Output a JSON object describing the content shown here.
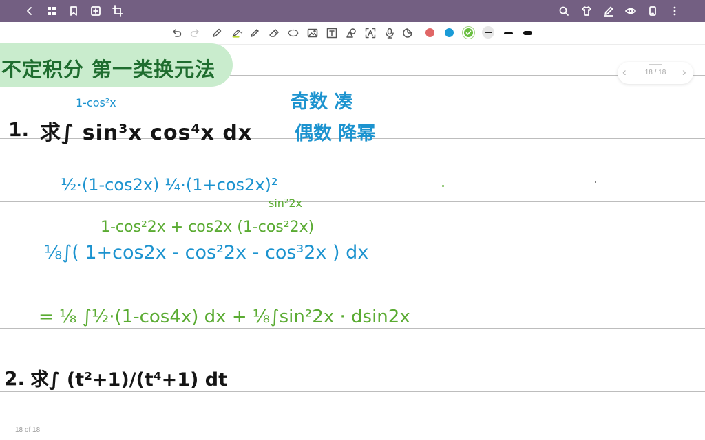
{
  "title_text": "不定积分 第一类换元法",
  "pager": {
    "text": "18 / 18",
    "prev": "‹",
    "next": "›"
  },
  "footer": {
    "page_count": "18 of 18"
  },
  "colors": {
    "topbar": "#735f82",
    "title_band": "#c9eccd",
    "ink_blue": "#1c93cf",
    "ink_green": "#5aab32",
    "swatch_red": "#e06666",
    "swatch_blue": "#1a9bd7",
    "swatch_green": "#6abf40",
    "swatch_gray": "#e6e6e6"
  },
  "topbar_icons": {
    "left": [
      "back-icon",
      "grid-icon",
      "bookmark-icon",
      "add-page-icon",
      "crop-icon"
    ],
    "right": [
      "search-icon",
      "tshirt-icon",
      "pen-mode-icon",
      "eye-icon",
      "tablet-icon",
      "more-icon"
    ]
  },
  "toolbar_tools": [
    "undo-icon",
    "redo-icon",
    "pen-icon",
    "highlighter-icon",
    "pencil-icon",
    "eraser-icon",
    "lasso-icon",
    "image-icon",
    "text-box-icon",
    "shapes-icon",
    "text-recognize-icon",
    "microphone-icon",
    "sticker-icon"
  ],
  "notes": {
    "problem1": {
      "number": "1.",
      "text": "求∫ sin³x cos⁴x dx",
      "annotation_top": "1-cos²x",
      "side_note_line1": "奇数 凑",
      "side_note_line2": "偶数 降幂"
    },
    "step1": "½·(1-cos2x) ¼·(1+cos2x)²",
    "step2_sup": "sin²2x",
    "step2_top": "1-cos²2x  + cos2x (1-cos²2x)",
    "step2_main": "⅛∫( 1+cos2x - cos²2x - cos³2x ) dx",
    "step3": "= ⅛ ∫½·(1-cos4x) dx + ⅛∫sin²2x · dsin2x",
    "problem2": {
      "number": "2.",
      "text": "求∫ (t²+1)/(t⁴+1) dt"
    }
  }
}
